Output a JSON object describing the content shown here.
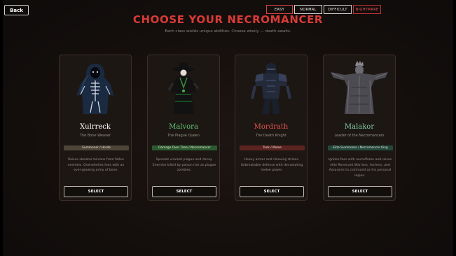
{
  "nav": {
    "back_label": "Back"
  },
  "difficulty": {
    "options": [
      "EASY",
      "NORMAL",
      "DIFFICULT",
      "NIGHTMARE"
    ],
    "selected": "EASY"
  },
  "header": {
    "title": "CHOOSE YOUR NECROMANCER",
    "subtitle": "Each class wields unique abilities. Choose wisely — death awaits."
  },
  "classes": [
    {
      "name": "Xulrreck",
      "role": "The Bone Weaver",
      "tag": "Summoner / Horde",
      "description": "Raises skeletal minions from fallen enemies. Overwhelms foes with an ever-growing army of bone.",
      "select_label": "SELECT",
      "name_color": "#ffffff",
      "tag_color": "#4d4538"
    },
    {
      "name": "Malvora",
      "role": "The Plague Queen",
      "tag": "Damage Over Time / Necromancer",
      "description": "Spreads virulent plague and decay. Enemies killed by poison rise as plague zombies.",
      "select_label": "SELECT",
      "name_color": "#5cc46c",
      "tag_color": "#2b5a30"
    },
    {
      "name": "Mordrath",
      "role": "The Death Knight",
      "tag": "Tank / Melee",
      "description": "Heavy armor and cleaving strikes. Unbreakable defense with devastating melee power.",
      "select_label": "SELECT",
      "name_color": "#e0504a",
      "tag_color": "#5c2320"
    },
    {
      "name": "Malakor",
      "role": "Leader of the Necromancers",
      "tag": "Elite Summoner / Necromancer King",
      "description": "Ignites foes with necroflame and raises elite Revenant Warriors, Archers, and Assassins to command as his personal legion.",
      "select_label": "SELECT",
      "name_color": "#7fc9a0",
      "tag_color": "#24483c"
    }
  ]
}
